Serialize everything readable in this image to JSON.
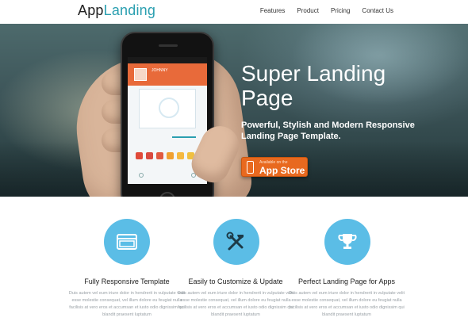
{
  "header": {
    "logo_main": "App",
    "logo_accent": "Landing",
    "nav": [
      "Features",
      "Product",
      "Pricing",
      "Contact Us"
    ]
  },
  "hero": {
    "title": "Super Landing Page",
    "subtitle": "Powerful, Stylish and Modern Responsive Landing Page Template.",
    "store_button": {
      "small_text": "Available on the",
      "label": "App Store",
      "icon": "phone-icon"
    },
    "phone_screen": {
      "profile_name": "JOHNNY"
    }
  },
  "features": [
    {
      "icon": "browser-window-icon",
      "title": "Fully Responsive Template",
      "text": "Duis autem vel eum iriure dolor in hendrerit in vulputate velit esse molestie consequat, vel illum dolore eu feugiat nulla facilisis at vero eros et accumsan et iusto odio dignissim qui blandit praesent luptatum"
    },
    {
      "icon": "tools-icon",
      "title": "Easily to Customize & Update",
      "text": "Duis autem vel eum iriure dolor in hendrerit in vulputate velit esse molestie consequat, vel illum dolore eu feugiat nulla facilisis at vero eros et accumsan et iusto odio dignissim qui blandit praesent luptatum"
    },
    {
      "icon": "trophy-icon",
      "title": "Perfect Landing Page for Apps",
      "text": "Duis autem vel eum iriure dolor in hendrerit in vulputate velit esse molestie consequat, vel illum dolore eu feugiat nulla facilisis at vero eros et accumsan et iusto odio dignissim qui blandit praesent luptatum"
    }
  ],
  "colors": {
    "accent": "#2a9fb0",
    "feature_circle": "#5bbde6",
    "store_button": "#e8691f"
  }
}
